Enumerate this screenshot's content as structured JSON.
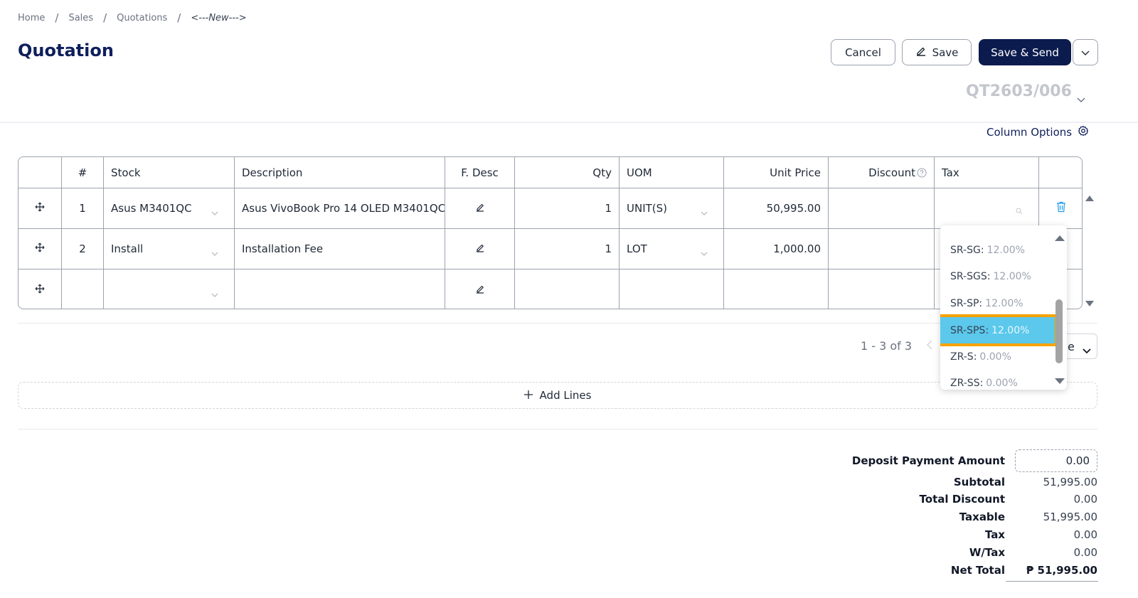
{
  "breadcrumb": {
    "items": [
      "Home",
      "Sales",
      "Quotations"
    ],
    "current": "<---New--->"
  },
  "page_title": "Quotation",
  "header_actions": {
    "cancel": "Cancel",
    "save": "Save",
    "save_send": "Save & Send"
  },
  "doc_number": "QT2603/006",
  "column_options": "Column Options",
  "table": {
    "headers": {
      "num": "#",
      "stock": "Stock",
      "description": "Description",
      "fdesc": "F. Desc",
      "qty": "Qty",
      "uom": "UOM",
      "unit_price": "Unit Price",
      "discount": "Discount",
      "tax": "Tax"
    },
    "rows": [
      {
        "num": "1",
        "stock": "Asus M3401QC",
        "description": "Asus VivoBook Pro 14 OLED M3401QC-",
        "qty": "1",
        "uom": "UNIT(S)",
        "unit_price": "50,995.00"
      },
      {
        "num": "2",
        "stock": "Install",
        "description": "Installation Fee",
        "qty": "1",
        "uom": "LOT",
        "unit_price": "1,000.00"
      },
      {
        "num": "",
        "stock": "",
        "description": "",
        "qty": "",
        "uom": "",
        "unit_price": ""
      }
    ]
  },
  "pagination": {
    "range": "1 - 3 of 3",
    "page_size_partial": "e"
  },
  "add_lines": "Add Lines",
  "tax_dropdown": {
    "options": [
      {
        "code": "SR-SG:",
        "rate": "12.00%"
      },
      {
        "code": "SR-SGS:",
        "rate": "12.00%"
      },
      {
        "code": "SR-SP:",
        "rate": "12.00%"
      },
      {
        "code": "SR-SPS:",
        "rate": "12.00%",
        "selected": true
      },
      {
        "code": "ZR-S:",
        "rate": "0.00%"
      },
      {
        "code": "ZR-SS:",
        "rate": "0.00%"
      }
    ]
  },
  "totals": {
    "deposit_label": "Deposit Payment Amount",
    "deposit_value": "0.00",
    "subtotal_label": "Subtotal",
    "subtotal_value": "51,995.00",
    "total_discount_label": "Total Discount",
    "total_discount_value": "0.00",
    "taxable_label": "Taxable",
    "taxable_value": "51,995.00",
    "tax_label": "Tax",
    "tax_value": "0.00",
    "wtax_label": "W/Tax",
    "wtax_value": "0.00",
    "net_total_label": "Net Total",
    "net_total_value": "₱ 51,995.00"
  },
  "colors": {
    "brand_navy": "#0b1b4d",
    "selected_option": "#5bc8ec",
    "highlight_outline": "#f5a300",
    "trash_blue": "#1d9bf0"
  }
}
